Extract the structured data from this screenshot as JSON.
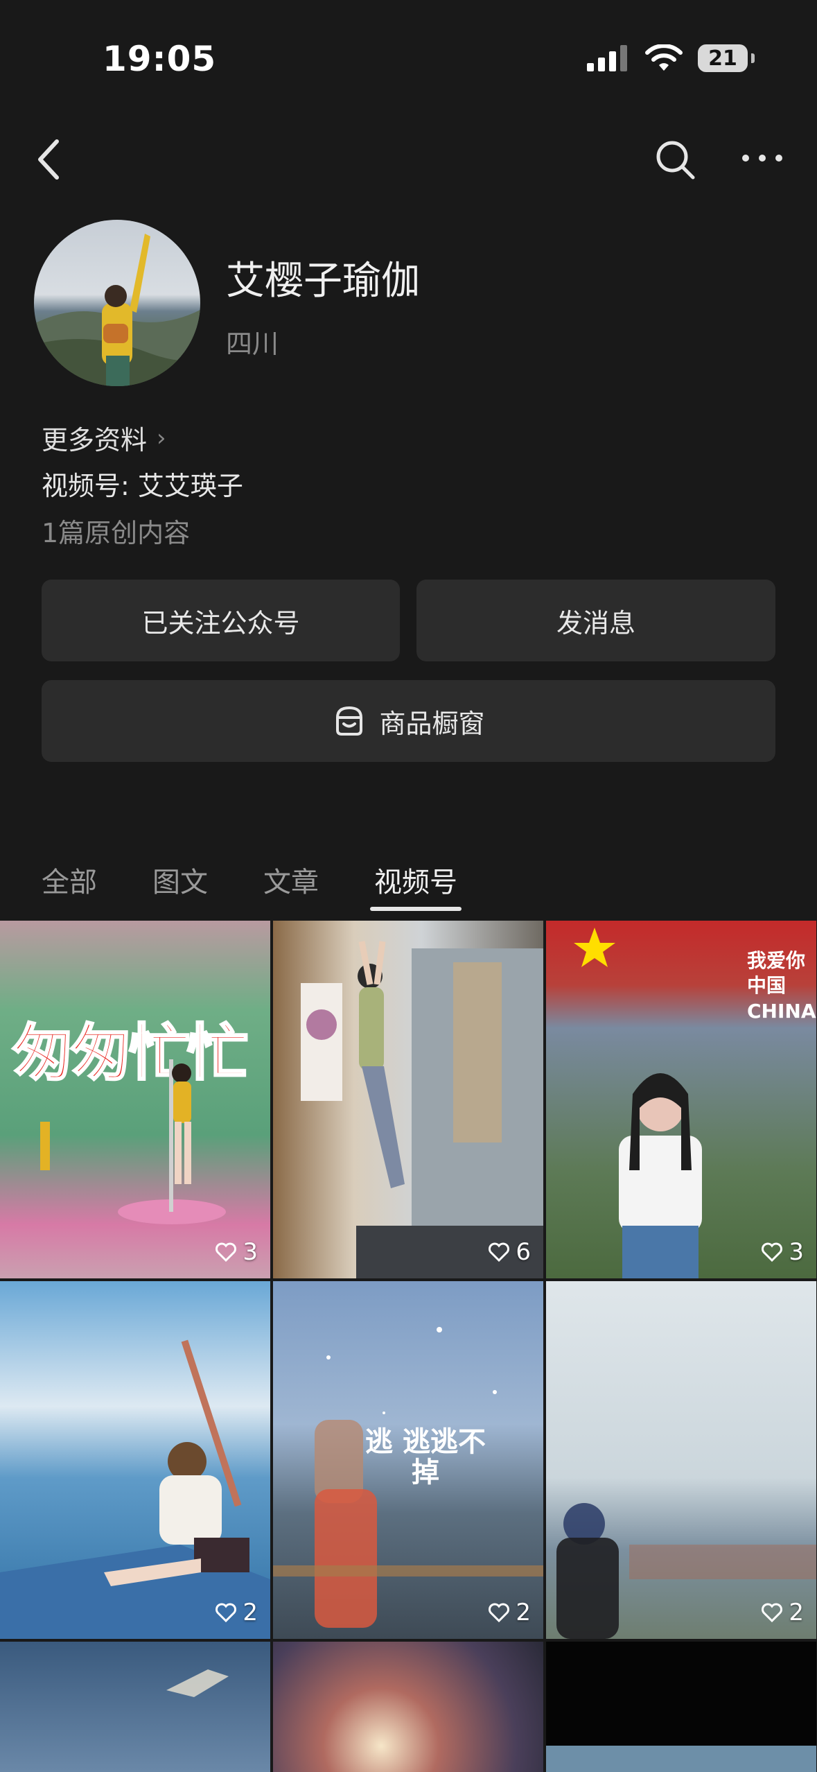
{
  "status_bar": {
    "time": "19:05",
    "battery": "21"
  },
  "icons": {
    "back": "chevron-left-icon",
    "search": "search-icon",
    "more": "more-horizontal-icon",
    "shop": "shop-window-icon",
    "like": "heart-icon"
  },
  "profile": {
    "name": "艾樱子瑜伽",
    "region": "四川",
    "more_info": "更多资料",
    "channel": "视频号: 艾艾瑛子",
    "original_count": "1篇原创内容"
  },
  "actions": {
    "follow": "已关注公众号",
    "message": "发消息",
    "shop": "商品橱窗"
  },
  "tabs": [
    {
      "label": "全部",
      "active": false
    },
    {
      "label": "图文",
      "active": false
    },
    {
      "label": "文章",
      "active": false
    },
    {
      "label": "视频号",
      "active": true
    }
  ],
  "videos": [
    {
      "likes": "3",
      "overlay": "匆匆忙忙"
    },
    {
      "likes": "6",
      "overlay": ""
    },
    {
      "likes": "3",
      "overlay": "我爱你中国 CHINA"
    },
    {
      "likes": "2",
      "overlay": ""
    },
    {
      "likes": "2",
      "overlay": "逃 逃逃不掉"
    },
    {
      "likes": "2",
      "overlay": ""
    }
  ],
  "colors": {
    "background": "#191919",
    "button": "#2c2c2c",
    "muted_text": "#8a8a8a"
  }
}
